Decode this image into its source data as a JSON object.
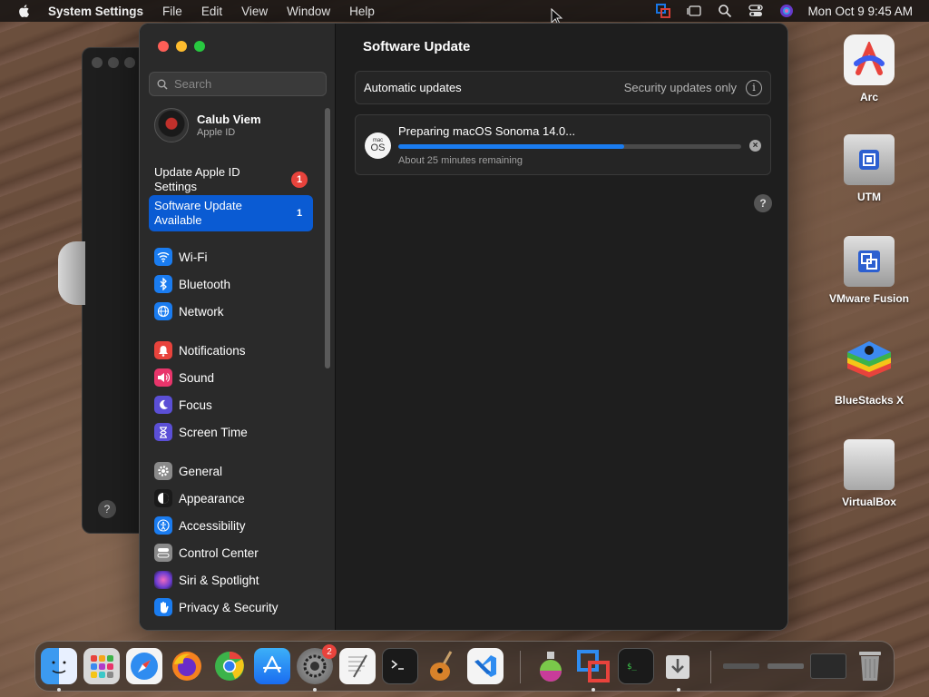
{
  "menubar": {
    "app_name": "System Settings",
    "menus": [
      "File",
      "Edit",
      "View",
      "Window",
      "Help"
    ],
    "clock": "Mon Oct 9  9:45 AM"
  },
  "window": {
    "search_placeholder": "Search",
    "account": {
      "name": "Calub Viem",
      "subtitle": "Apple ID"
    },
    "notices": [
      {
        "label": "Update Apple ID Settings",
        "badge": "1"
      },
      {
        "label": "Software Update Available",
        "badge": "1"
      }
    ],
    "nav_groups": [
      [
        {
          "label": "Wi-Fi",
          "icon": "wifi-icon",
          "color": "#1a7cf0"
        },
        {
          "label": "Bluetooth",
          "icon": "bluetooth-icon",
          "color": "#1a7cf0"
        },
        {
          "label": "Network",
          "icon": "network-globe-icon",
          "color": "#1a7cf0"
        }
      ],
      [
        {
          "label": "Notifications",
          "icon": "bell-icon",
          "color": "#e8433c"
        },
        {
          "label": "Sound",
          "icon": "speaker-icon",
          "color": "#e8356b"
        },
        {
          "label": "Focus",
          "icon": "moon-icon",
          "color": "#5b4fd6"
        },
        {
          "label": "Screen Time",
          "icon": "hourglass-icon",
          "color": "#5b4fd6"
        }
      ],
      [
        {
          "label": "General",
          "icon": "gear-icon",
          "color": "#8a8a8a"
        },
        {
          "label": "Appearance",
          "icon": "appearance-icon",
          "color": "#1a1a1a"
        },
        {
          "label": "Accessibility",
          "icon": "accessibility-icon",
          "color": "#1a7cf0"
        },
        {
          "label": "Control Center",
          "icon": "control-center-icon",
          "color": "#8a8a8a"
        },
        {
          "label": "Siri & Spotlight",
          "icon": "siri-icon",
          "color": "#b03cc8"
        },
        {
          "label": "Privacy & Security",
          "icon": "hand-icon",
          "color": "#1a7cf0"
        }
      ]
    ],
    "content": {
      "title": "Software Update",
      "auto_updates": {
        "label": "Automatic updates",
        "value": "Security updates only"
      },
      "update": {
        "icon_line1": "mac",
        "icon_line2": "OS",
        "title": "Preparing macOS Sonoma 14.0...",
        "progress_fraction": 0.66,
        "remaining": "About 25 minutes remaining"
      },
      "help": "?"
    }
  },
  "bg_window": {
    "help": "?"
  },
  "desktop_icons": [
    {
      "label": "Arc",
      "icon": "arc-app-icon"
    },
    {
      "label": "UTM",
      "icon": "utm-drive-icon"
    },
    {
      "label": "VMware Fusion",
      "icon": "vmware-drive-icon"
    },
    {
      "label": "BlueStacks X",
      "icon": "bluestacks-icon"
    },
    {
      "label": "VirtualBox",
      "icon": "virtualbox-drive-icon"
    }
  ],
  "dock": {
    "settings_badge": "2",
    "items": [
      "finder-icon",
      "launchpad-icon",
      "safari-icon",
      "firefox-icon",
      "chrome-icon",
      "app-store-icon",
      "system-settings-icon",
      "textedit-icon",
      "terminal-icon",
      "garageband-icon",
      "vscode-icon",
      "potion-icon",
      "parallels-icon",
      "console-icon",
      "downloads-icon",
      "window-thumb-1-icon",
      "window-thumb-2-icon",
      "window-thumb-3-icon",
      "trash-icon"
    ]
  }
}
